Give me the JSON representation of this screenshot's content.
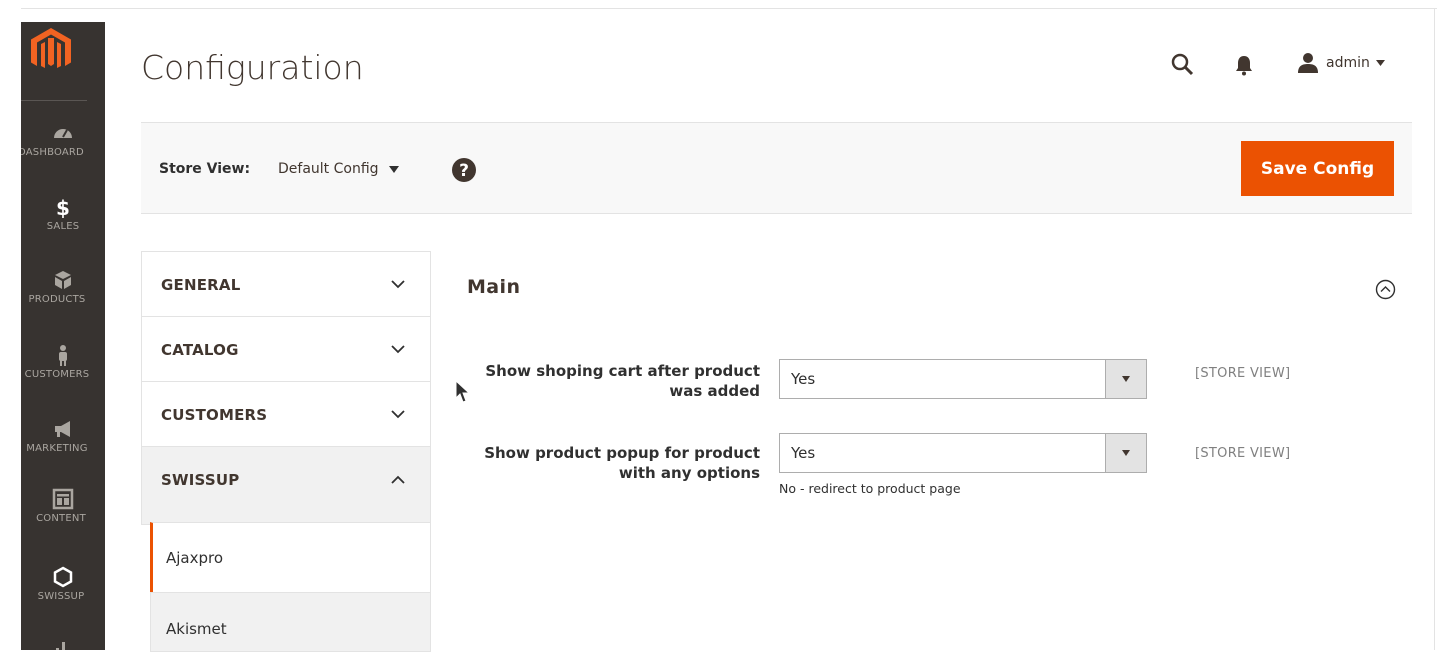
{
  "sidebar": {
    "logo_icon": "magento-logo",
    "items": [
      {
        "label": "DASHBOARD",
        "icon": "dashboard-icon"
      },
      {
        "label": "SALES",
        "icon": "dollar-icon"
      },
      {
        "label": "PRODUCTS",
        "icon": "cube-icon"
      },
      {
        "label": "CUSTOMERS",
        "icon": "person-icon"
      },
      {
        "label": "MARKETING",
        "icon": "megaphone-icon"
      },
      {
        "label": "CONTENT",
        "icon": "layout-icon"
      },
      {
        "label": "SWISSUP",
        "icon": "hexagon-icon"
      }
    ]
  },
  "header": {
    "title": "Configuration",
    "user_name": "admin"
  },
  "store_bar": {
    "label": "Store View:",
    "selected": "Default Config",
    "save_label": "Save Config"
  },
  "tabs": [
    {
      "label": "GENERAL",
      "state": "collapsed"
    },
    {
      "label": "CATALOG",
      "state": "collapsed"
    },
    {
      "label": "CUSTOMERS",
      "state": "collapsed"
    },
    {
      "label": "SWISSUP",
      "state": "expanded"
    }
  ],
  "subtabs": [
    {
      "label": "Ajaxpro",
      "active": true
    },
    {
      "label": "Akismet",
      "active": false
    }
  ],
  "section": {
    "title": "Main",
    "fields": [
      {
        "label_line1": "Show shoping cart after product",
        "label_line2": "was added",
        "value": "Yes",
        "scope": "[STORE VIEW]",
        "note": ""
      },
      {
        "label_line1": "Show product popup for product",
        "label_line2": "with any options",
        "value": "Yes",
        "scope": "[STORE VIEW]",
        "note": "No - redirect to product page"
      }
    ]
  },
  "colors": {
    "accent": "#eb5202",
    "sidebar_bg": "#373330",
    "logo": "#f26322"
  }
}
